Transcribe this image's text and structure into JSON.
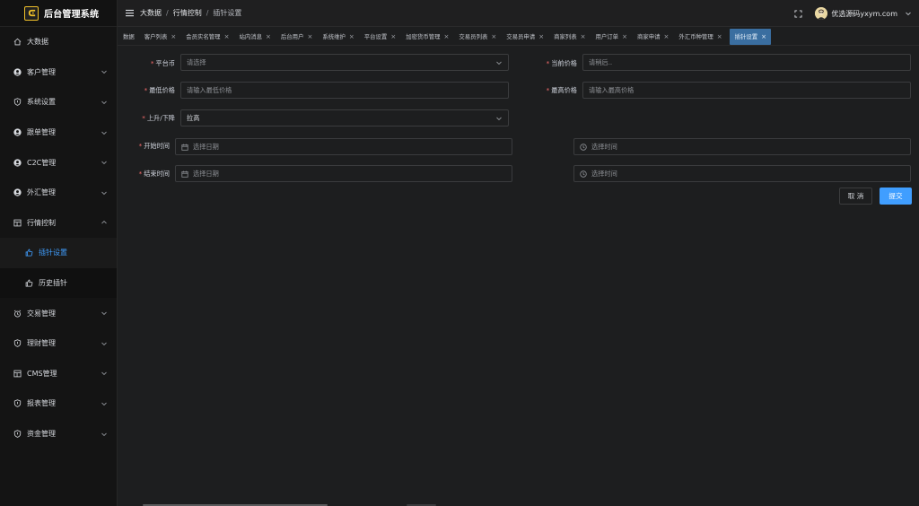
{
  "app": {
    "title": "后台管理系统"
  },
  "sidebar": {
    "items": [
      {
        "label": "大数据",
        "icon": "home-icon",
        "expandable": false
      },
      {
        "label": "客户管理",
        "icon": "user-circle-icon",
        "expandable": true
      },
      {
        "label": "系统设置",
        "icon": "shield-icon",
        "expandable": true
      },
      {
        "label": "跟单管理",
        "icon": "user-circle-icon",
        "expandable": true
      },
      {
        "label": "C2C管理",
        "icon": "user-circle-icon",
        "expandable": true
      },
      {
        "label": "外汇管理",
        "icon": "user-circle-icon",
        "expandable": true
      },
      {
        "label": "行情控制",
        "icon": "grid-icon",
        "expandable": true,
        "expanded": true,
        "children": [
          {
            "label": "插针设置",
            "icon": "thumb-icon",
            "active": true
          },
          {
            "label": "历史插针",
            "icon": "thumb-icon",
            "active": false
          }
        ]
      },
      {
        "label": "交易管理",
        "icon": "alarm-icon",
        "expandable": true
      },
      {
        "label": "理财管理",
        "icon": "shield-icon",
        "expandable": true
      },
      {
        "label": "CMS管理",
        "icon": "grid-icon",
        "expandable": true
      },
      {
        "label": "报表管理",
        "icon": "shield-icon",
        "expandable": true
      },
      {
        "label": "资金管理",
        "icon": "shield-icon",
        "expandable": true
      }
    ]
  },
  "header": {
    "breadcrumb": [
      "大数据",
      "行情控制",
      "插针设置"
    ],
    "username": "优选源码yxym.com"
  },
  "tags": [
    {
      "label": "数据",
      "closable": false,
      "active": false
    },
    {
      "label": "客户列表",
      "closable": true,
      "active": false
    },
    {
      "label": "会员实名管理",
      "closable": true,
      "active": false
    },
    {
      "label": "站内消息",
      "closable": true,
      "active": false
    },
    {
      "label": "后台用户",
      "closable": true,
      "active": false
    },
    {
      "label": "系统维护",
      "closable": true,
      "active": false
    },
    {
      "label": "平台设置",
      "closable": true,
      "active": false
    },
    {
      "label": "加密货币管理",
      "closable": true,
      "active": false
    },
    {
      "label": "交易员列表",
      "closable": true,
      "active": false
    },
    {
      "label": "交易员申请",
      "closable": true,
      "active": false
    },
    {
      "label": "商家列表",
      "closable": true,
      "active": false
    },
    {
      "label": "用户订单",
      "closable": true,
      "active": false
    },
    {
      "label": "商家申请",
      "closable": true,
      "active": false
    },
    {
      "label": "外汇币种管理",
      "closable": true,
      "active": false
    },
    {
      "label": "插针设置",
      "closable": true,
      "active": true
    }
  ],
  "form": {
    "platform_coin": {
      "label": "平台币",
      "placeholder": "请选择",
      "value": ""
    },
    "current_price": {
      "label": "当前价格",
      "placeholder": "请稍后..",
      "value": ""
    },
    "min_price": {
      "label": "最低价格",
      "placeholder": "请输入最低价格",
      "value": ""
    },
    "max_price": {
      "label": "最高价格",
      "placeholder": "请输入最高价格",
      "value": ""
    },
    "direction": {
      "label": "上升/下降",
      "placeholder": "",
      "value": "拉高"
    },
    "start_time": {
      "label": "开始时间",
      "date_placeholder": "选择日期",
      "time_placeholder": "选择时间"
    },
    "end_time": {
      "label": "结束时间",
      "date_placeholder": "选择日期",
      "time_placeholder": "选择时间"
    },
    "cancel_label": "取 消",
    "submit_label": "提交"
  },
  "colors": {
    "accent": "#409eff",
    "required": "#f56c6c",
    "logo": "#f0c02a"
  }
}
